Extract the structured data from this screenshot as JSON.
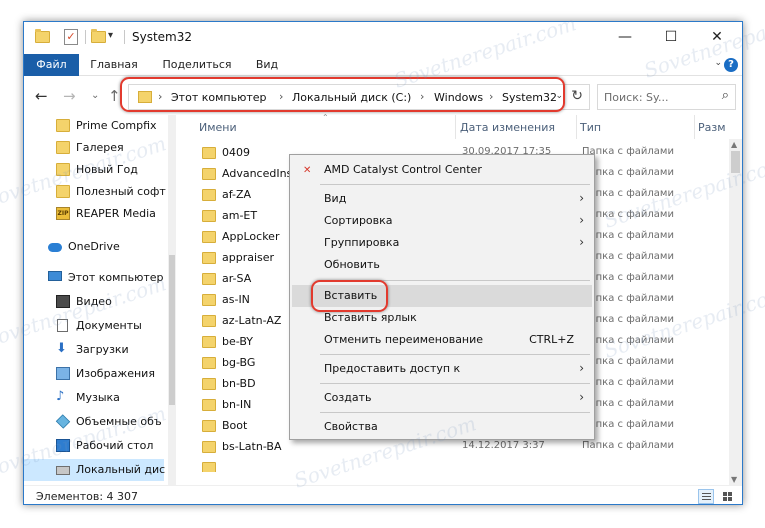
{
  "window": {
    "title": "System32",
    "minimize_glyph": "—",
    "maximize_glyph": "☐",
    "close_glyph": "✕"
  },
  "ribbon": {
    "tabs": [
      "Файл",
      "Главная",
      "Поделиться",
      "Вид"
    ],
    "expand_glyph": "⌄",
    "help_glyph": "?"
  },
  "nav": {
    "back_glyph": "←",
    "forward_glyph": "→",
    "recent_glyph": "⌄",
    "up_glyph": "↑",
    "address_chevron": "›",
    "address": [
      "Этот компьютер",
      "Локальный диск (C:)",
      "Windows",
      "System32"
    ],
    "address_dropdown_glyph": "⌄",
    "refresh_glyph": "↻",
    "search_placeholder": "Поиск: Sy...",
    "search_glyph": "⌕"
  },
  "sidebar": {
    "items": [
      {
        "label": "Prime Compfix",
        "icon": "folder-icon"
      },
      {
        "label": "Галерея",
        "icon": "folder-icon"
      },
      {
        "label": "Новый Год",
        "icon": "folder-icon"
      },
      {
        "label": "Полезный софт",
        "icon": "folder-icon"
      },
      {
        "label": "REAPER Media",
        "icon": "zip-folder-icon",
        "badge": "ZIP"
      },
      {
        "label": "OneDrive",
        "icon": "cloud-icon"
      },
      {
        "label": "Этот компьютер",
        "icon": "computer-icon"
      },
      {
        "label": "Видео",
        "icon": "video-icon"
      },
      {
        "label": "Документы",
        "icon": "documents-icon"
      },
      {
        "label": "Загрузки",
        "icon": "downloads-icon",
        "glyph": "⬇"
      },
      {
        "label": "Изображения",
        "icon": "pictures-icon"
      },
      {
        "label": "Музыка",
        "icon": "music-icon",
        "glyph": "♪"
      },
      {
        "label": "Объемные объ",
        "icon": "3d-objects-icon"
      },
      {
        "label": "Рабочий стол",
        "icon": "desktop-icon"
      },
      {
        "label": "Локальный дис",
        "icon": "drive-icon"
      }
    ]
  },
  "columns": {
    "name": "Имени",
    "date": "Дата изменения",
    "type": "Тип",
    "size": "Разм",
    "sort_glyph": "⌃"
  },
  "files": [
    {
      "name": "0409",
      "date": "30.09.2017 17:35",
      "type": "Папка с файлами"
    },
    {
      "name": "AdvancedIns",
      "date": "",
      "type": "Папка с файлами"
    },
    {
      "name": "af-ZA",
      "date": "",
      "type": "Папка с файлами"
    },
    {
      "name": "am-ET",
      "date": "",
      "type": "Папка с файлами"
    },
    {
      "name": "AppLocker",
      "date": "",
      "type": "Папка с файлами"
    },
    {
      "name": "appraiser",
      "date": "",
      "type": "Папка с файлами"
    },
    {
      "name": "ar-SA",
      "date": "",
      "type": "Папка с файлами"
    },
    {
      "name": "as-IN",
      "date": "",
      "type": "Папка с файлами"
    },
    {
      "name": "az-Latn-AZ",
      "date": "",
      "type": "Папка с файлами"
    },
    {
      "name": "be-BY",
      "date": "",
      "type": "Папка с файлами"
    },
    {
      "name": "bg-BG",
      "date": "",
      "type": "Папка с файлами"
    },
    {
      "name": "bn-BD",
      "date": "",
      "type": "Папка с файлами"
    },
    {
      "name": "bn-IN",
      "date": "",
      "type": "Папка с файлами"
    },
    {
      "name": "Boot",
      "date": "",
      "type": "Папка с файлами"
    },
    {
      "name": "bs-Latn-BA",
      "date": "14.12.2017 3:37",
      "type": "Папка с файлами"
    },
    {
      "name": "",
      "date": "",
      "type": ""
    }
  ],
  "context_menu": {
    "amd": "AMD Catalyst Control Center",
    "amd_glyph": "✕",
    "submenu_glyph": "›",
    "view": "Вид",
    "sort": "Сортировка",
    "group": "Группировка",
    "refresh": "Обновить",
    "paste": "Вставить",
    "paste_shortcut": "Вставить ярлык",
    "undo_rename": "Отменить переименование",
    "undo_key": "CTRL+Z",
    "share": "Предоставить доступ к",
    "create": "Создать",
    "properties": "Свойства"
  },
  "status": {
    "items": "Элементов: 4 307"
  },
  "scroll": {
    "up_glyph": "▲",
    "down_glyph": "▼"
  },
  "watermark": "Sovetnerepair.com",
  "qa": {
    "check_glyph": "✓",
    "down_glyph": "▾"
  }
}
